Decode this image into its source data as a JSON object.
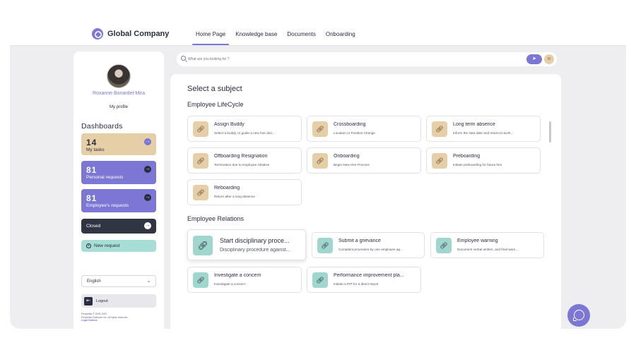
{
  "brand": {
    "name": "Global Company",
    "accent": "#7c76d4"
  },
  "nav": {
    "items": [
      {
        "label": "Home Page",
        "active": true
      },
      {
        "label": "Knowledge base",
        "active": false
      },
      {
        "label": "Documents",
        "active": false
      },
      {
        "label": "Onboarding",
        "active": false
      }
    ]
  },
  "search": {
    "placeholder": "What are you looking for ?",
    "send_icon": "send-icon",
    "user_icon": "user-group-icon"
  },
  "sidebar": {
    "user_name": "Roxanne Bonardel-Mira",
    "profile_link": "My profile",
    "dashboards_title": "Dashboards",
    "cards": {
      "tasks": {
        "count": "14",
        "label": "My tasks"
      },
      "personal": {
        "count": "81",
        "label": "Personal requests"
      },
      "employees": {
        "count": "81",
        "label": "Employee's requests"
      },
      "closed": {
        "label": "Closed"
      }
    },
    "new_request": "New request",
    "language": "English",
    "logout": "Logout",
    "footer": {
      "copyright": "Peoplelist © 2009-2021",
      "company": "Peoplelist Software Inc. All rights reserved.",
      "legal": "Legal Notices"
    }
  },
  "main": {
    "title": "Select a subject",
    "lifecycle": {
      "title": "Employee LifeCycle",
      "tiles": [
        {
          "title": "Assign Buddy",
          "desc": "Select a buddy, to guide a new hire duri..."
        },
        {
          "title": "Crossboarding",
          "desc": "Location or Position Change"
        },
        {
          "title": "Long term absence",
          "desc": "Inform the  start date and return-to-work..."
        },
        {
          "title": "Offboarding Resignation",
          "desc": "Termination due to employee initiative"
        },
        {
          "title": "Onboarding",
          "desc": "Begin New Hire Process"
        },
        {
          "title": "Preboarding",
          "desc": "Initiate preboarding for future hire"
        },
        {
          "title": "Reboarding",
          "desc": "Return after a long absence"
        }
      ]
    },
    "relations": {
      "title": "Employee Relations",
      "tiles": [
        {
          "title": "Start disciplinary proce...",
          "desc": "Disciplinary procedure against..."
        },
        {
          "title": "Submit a grievance",
          "desc": "Complaint procedure by one employee ag..."
        },
        {
          "title": "Employee warning",
          "desc": "Document verbal written, and final warn..."
        },
        {
          "title": "Investigate a concern",
          "desc": "Investigate a concern"
        },
        {
          "title": "Performance improvement pla...",
          "desc": "Initiate a PIP for a direct report"
        }
      ]
    }
  },
  "colors": {
    "tan": "#e6cfa6",
    "teal": "#9fd6cd",
    "dark": "#2f3543",
    "purple": "#7c76d4"
  }
}
